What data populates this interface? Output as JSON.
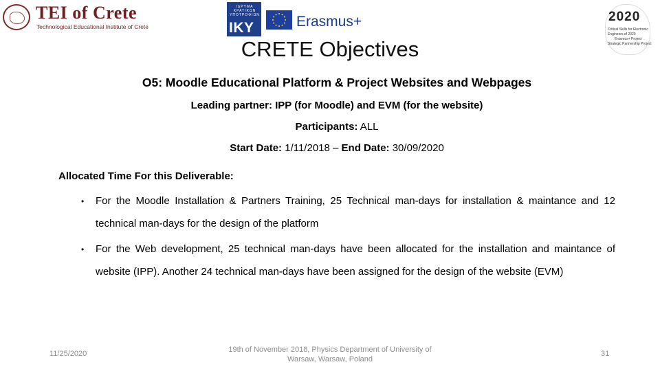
{
  "header": {
    "tei_logo": {
      "title": "TEI of Crete",
      "subtitle": "Technological Educational Institute of Crete"
    },
    "iky_logo": {
      "small_text": "ΙΔΡΥΜΑ ΚΡΑΤΙΚΩΝ ΥΠΟΤΡΟΦΙΩΝ",
      "big_text": "IKY"
    },
    "erasmus_logo": {
      "text": "Erasmus+"
    },
    "project_logo": {
      "number": "2020",
      "lines": [
        "Critical Skills for Electronic",
        "Engineers of 2020",
        "Erasmus+ Project",
        "Strategic Partnership Project"
      ]
    }
  },
  "slide": {
    "title": "CRETE Objectives",
    "objective": "O5: Moodle Educational Platform & Project Websites and Webpages",
    "leading_label": "Leading partner: IPP (for Moodle) and EVM (for the website)",
    "participants_label": "Participants:",
    "participants_value": " ALL",
    "start_label": "Start Date:",
    "start_value": " 1/11/2018 – ",
    "end_label": "End Date:",
    "end_value": " 30/09/2020",
    "allocated_heading": "Allocated Time For this Deliverable:",
    "bullets": [
      "For the Moodle Installation & Partners Training, 25 Technical man-days for installation & maintance and 12 technical man-days for the design of the platform",
      "For the Web development, 25 technical man-days have been allocated for the installation and maintance of website (IPP). Another 24 technical man-days have been assigned for the design of the website (EVM)"
    ],
    "bullet_glyph": "•"
  },
  "footer": {
    "date": "11/25/2020",
    "center": "19th of November 2018, Physics Department of University of Warsaw, Warsaw, Poland",
    "page_number": "31"
  },
  "colors": {
    "tei_maroon": "#6e1f22",
    "iky_blue": "#1f3f8c",
    "erasmus_blue": "#1a3d8f",
    "eu_star": "#ffdd00",
    "footer_gray": "#8c8c8c"
  }
}
